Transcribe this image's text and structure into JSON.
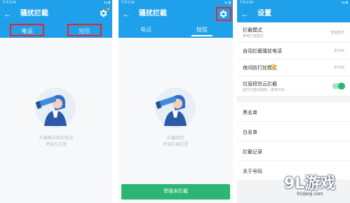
{
  "screens": [
    {
      "status_left": "下午3:34",
      "status_right": "▾▴ ▮",
      "title": "骚扰拦截",
      "tabs": [
        {
          "label": "电话",
          "active": true,
          "highlighted": true
        },
        {
          "label": "短信",
          "active": false,
          "highlighted": true
        }
      ],
      "empty_lines": [
        "拦截模式前的电话",
        "将会在这里"
      ],
      "gear_highlighted": false,
      "button": ""
    },
    {
      "status_left": "下午3:34",
      "status_right": "▾▴ ▮",
      "title": "骚扰拦截",
      "tabs": [
        {
          "label": "电话",
          "active": false,
          "highlighted": false
        },
        {
          "label": "短信",
          "active": true,
          "highlighted": false
        }
      ],
      "empty_lines": [
        "拦截短信",
        "将会拦截这里"
      ],
      "gear_highlighted": true,
      "button": "举报未拦截"
    },
    {
      "status_left": "下午3:34",
      "status_right": "▾▴ ▮",
      "title": "设置",
      "rows": [
        {
          "label": "拦截模式",
          "sub": "推荐拦截模式",
          "value": "智能模式"
        },
        {
          "label": "自动拦截骚扰电话",
          "sub": "",
          "value": "未开启"
        },
        {
          "label": "夜间防打扰模式",
          "sub": "",
          "value": "未开启",
          "badge": "新"
        },
        {
          "label": "垃圾短信云拦截",
          "sub": "提升拦截准确率，推荐开启",
          "value": "",
          "toggle": true
        }
      ],
      "lists": [
        "黑名单",
        "白名单",
        "拦截记录",
        "关于号码"
      ]
    }
  ],
  "watermark": {
    "logo": "9L游戏",
    "url": "91danji.com"
  },
  "colors": {
    "primary": "#1ea0ea",
    "green": "#2bb673",
    "highlight_box": "#e8252b",
    "badge": "#f2a92c"
  },
  "icons": [
    "back-arrow-icon",
    "gear-icon",
    "telescope-illustration",
    "toggle-switch"
  ]
}
